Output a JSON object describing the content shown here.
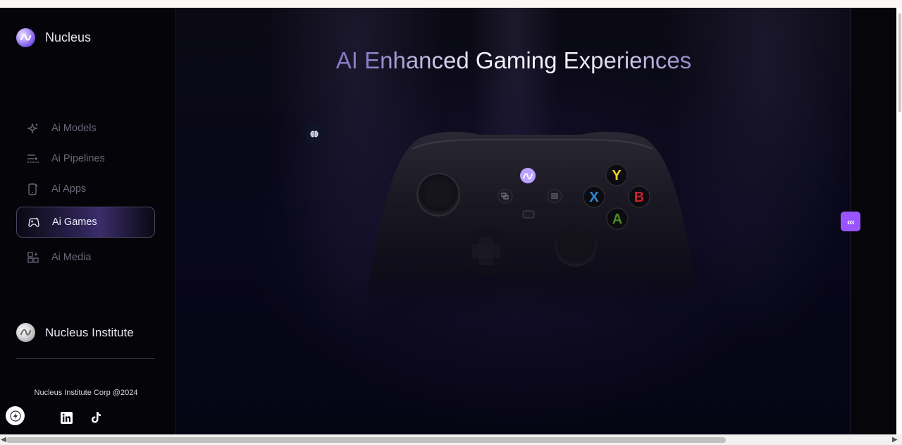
{
  "brand": {
    "name": "Nucleus"
  },
  "nav": {
    "items": [
      {
        "label": "Ai Models",
        "icon": "sparkles-icon",
        "active": false
      },
      {
        "label": "Ai Pipelines",
        "icon": "pipeline-icon",
        "active": false
      },
      {
        "label": "Ai Apps",
        "icon": "phone-apps-icon",
        "active": false
      },
      {
        "label": "Ai Games",
        "icon": "gamepad-icon",
        "active": true
      },
      {
        "label": "Ai Media",
        "icon": "media-grid-icon",
        "active": false
      }
    ]
  },
  "institute": {
    "name": "Nucleus Institute"
  },
  "footer": {
    "copyright": "Nucleus Institute Corp @2024"
  },
  "main": {
    "headline": "AI Enhanced Gaming Experiences",
    "collapse_label": "‹‹‹",
    "controller_buttons": [
      "Y",
      "X",
      "B",
      "A"
    ]
  },
  "colors": {
    "accent": "#9a54ff",
    "background": "#07060d",
    "button_y": "#e8d320",
    "button_x": "#2f8ad6",
    "button_b": "#c8232c",
    "button_a": "#4e8a2a"
  }
}
